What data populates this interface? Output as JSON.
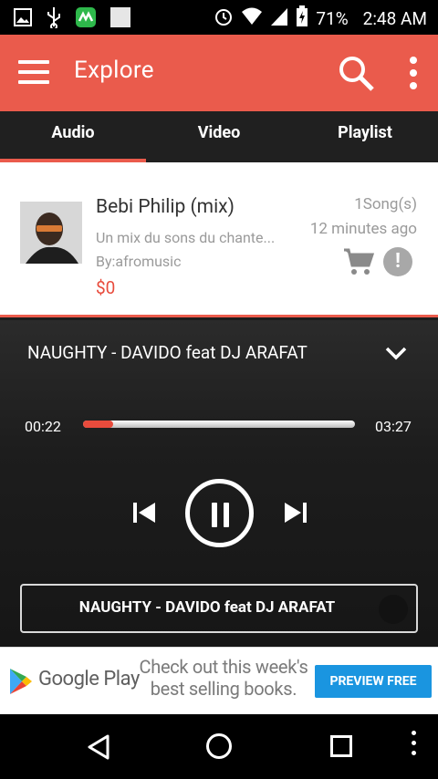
{
  "status_bar": {
    "battery_pct": "71%",
    "time": "2:48 AM",
    "icons": [
      "image-icon",
      "usb-icon",
      "app-notification-icon",
      "blank-notification-icon",
      "alarm-icon",
      "wifi-icon",
      "cell-signal-icon",
      "battery-charging-icon"
    ]
  },
  "appbar": {
    "title": "Explore",
    "color": "#ea5b4c",
    "icons": [
      "menu-icon",
      "search-icon",
      "more-vert-icon"
    ]
  },
  "tabs": [
    {
      "label": "Audio",
      "active": true
    },
    {
      "label": "Video",
      "active": false
    },
    {
      "label": "Playlist",
      "active": false
    }
  ],
  "item": {
    "title": "Bebi Philip (mix)",
    "description": "Un mix du sons du chante...",
    "author": "By:afromusic",
    "price": "$0",
    "song_count": "1Song(s)",
    "posted": "12 minutes ago",
    "icons": [
      "cart-icon",
      "info-icon"
    ]
  },
  "player": {
    "now_playing": "NAUGHTY - DAVIDO feat DJ ARAFAT",
    "current_time": "00:22",
    "total_time": "03:27",
    "progress_fraction": 0.11,
    "marquee_text": "NAUGHTY - DAVIDO feat DJ ARAFAT",
    "accent": "#e84b3c",
    "icons": [
      "chevron-down-icon",
      "skip-previous-icon",
      "pause-icon",
      "skip-next-icon"
    ]
  },
  "ad": {
    "brand": "Google Play",
    "message": "Check out this week's best selling books.",
    "cta": "PREVIEW FREE",
    "cta_color": "#1a95e0"
  },
  "navbar": {
    "icons": [
      "back-icon",
      "home-icon",
      "recents-icon",
      "overflow-icon"
    ]
  }
}
